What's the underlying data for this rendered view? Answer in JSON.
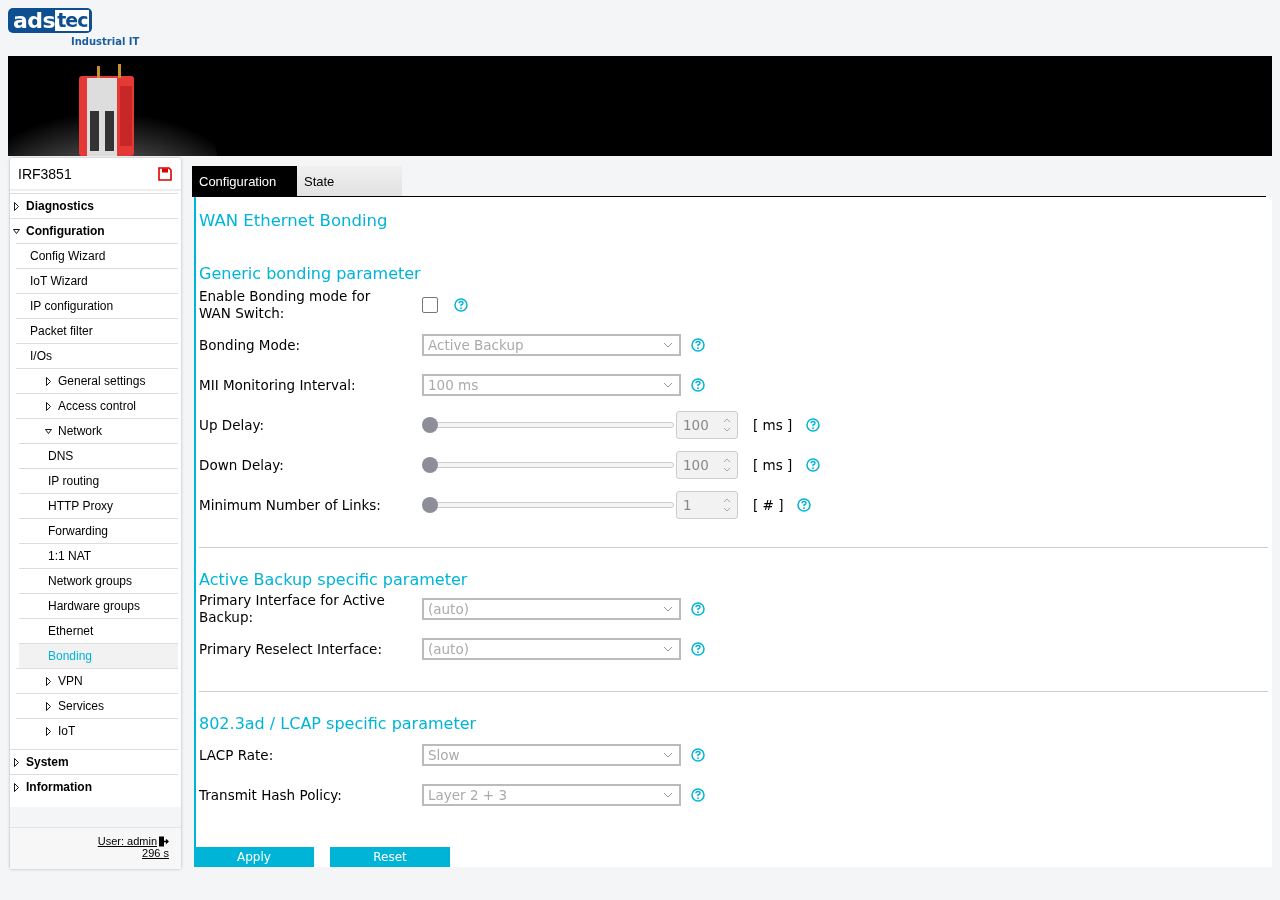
{
  "header": {
    "logo_left": "ads",
    "logo_right": "tec",
    "tagline": "Industrial IT"
  },
  "sidebar": {
    "device": "IRF3851",
    "items": [
      {
        "label": "Diagnostics",
        "expanded": false
      },
      {
        "label": "Configuration",
        "expanded": true,
        "children": [
          {
            "label": "Config Wizard"
          },
          {
            "label": "IoT Wizard"
          },
          {
            "label": "IP configuration"
          },
          {
            "label": "Packet filter"
          },
          {
            "label": "I/Os",
            "children": [
              {
                "label": "General settings",
                "expanded": false
              },
              {
                "label": "Access control",
                "expanded": false
              },
              {
                "label": "Network",
                "expanded": true,
                "children": [
                  {
                    "label": "DNS",
                    "selected": false
                  },
                  {
                    "label": "IP routing",
                    "selected": false
                  },
                  {
                    "label": "HTTP Proxy",
                    "selected": false
                  },
                  {
                    "label": "Forwarding",
                    "selected": false
                  },
                  {
                    "label": "1:1 NAT",
                    "selected": false
                  },
                  {
                    "label": "Network groups",
                    "selected": false
                  },
                  {
                    "label": "Hardware groups",
                    "selected": false
                  },
                  {
                    "label": "Ethernet",
                    "selected": false
                  },
                  {
                    "label": "Bonding",
                    "selected": true
                  }
                ]
              },
              {
                "label": "VPN",
                "expanded": false
              },
              {
                "label": "Services",
                "expanded": false
              },
              {
                "label": "IoT",
                "expanded": false
              }
            ]
          }
        ]
      },
      {
        "label": "System",
        "expanded": false
      },
      {
        "label": "Information",
        "expanded": false
      }
    ],
    "user": "User: admin",
    "timer": "296 s"
  },
  "tabs": [
    {
      "label": "Configuration",
      "selected": true
    },
    {
      "label": "State",
      "selected": false
    }
  ],
  "page_title": "WAN Ethernet Bonding",
  "sections": [
    {
      "title": "Generic bonding parameter",
      "rows": [
        {
          "kind": "checkbox",
          "label": "Enable Bonding mode for WAN Switch:",
          "checked": false
        },
        {
          "kind": "select",
          "label": "Bonding Mode:",
          "value": "Active Backup",
          "disabled": true
        },
        {
          "kind": "select",
          "label": "MII Monitoring Interval:",
          "value": "100 ms",
          "disabled": true
        },
        {
          "kind": "slider",
          "label": "Up Delay:",
          "level": 0,
          "value": "100",
          "unit": "[ ms ]",
          "disabled": true
        },
        {
          "kind": "slider",
          "label": "Down Delay:",
          "level": 0,
          "value": "100",
          "unit": "[ ms ]",
          "disabled": true
        },
        {
          "kind": "slider",
          "label": "Minimum Number of Links:",
          "level": 0,
          "value": "1",
          "unit": "[ # ]",
          "disabled": true
        }
      ]
    },
    {
      "title": "Active Backup specific parameter",
      "rows": [
        {
          "kind": "select",
          "label": "Primary Interface for Active Backup:",
          "value": "(auto)",
          "disabled": true
        },
        {
          "kind": "select",
          "label": "Primary Reselect Interface:",
          "value": "(auto)",
          "disabled": true
        }
      ]
    },
    {
      "title": "802.3ad / LCAP specific parameter",
      "rows": [
        {
          "kind": "select",
          "label": "LACP Rate:",
          "value": "Slow",
          "disabled": true
        },
        {
          "kind": "select",
          "label": "Transmit Hash Policy:",
          "value": "Layer 2 + 3",
          "disabled": true
        }
      ]
    }
  ],
  "buttons": [
    "Apply",
    "Reset"
  ]
}
